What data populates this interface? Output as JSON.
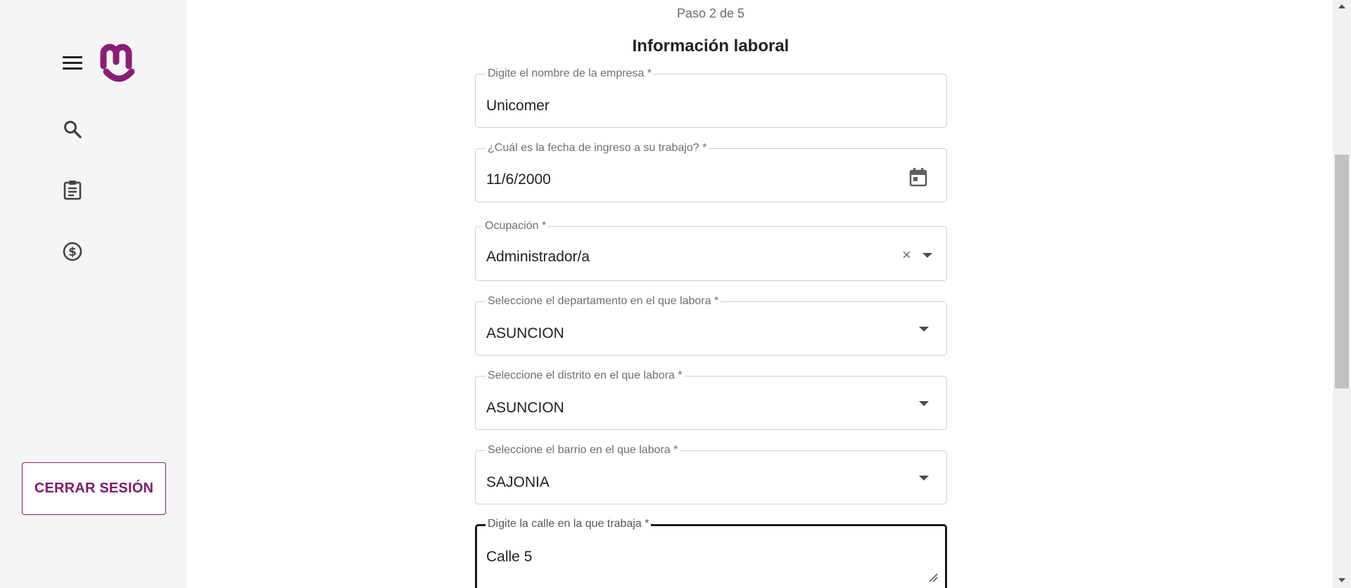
{
  "sidebar": {
    "logout_label": "CERRAR SESIÓN",
    "nav_icons": [
      "menu-icon",
      "search-icon",
      "clipboard-icon",
      "dollar-circle-icon"
    ],
    "brand_color": "#8b1e73"
  },
  "form": {
    "step": "Paso 2 de 5",
    "title": "Información laboral",
    "fields": [
      {
        "label": "Digite el nombre de la empresa *",
        "value": "Unicomer"
      },
      {
        "label": "¿Cuál es la fecha de ingreso a su trabajo? *",
        "value": "11/6/2000"
      },
      {
        "label": "Ocupación *",
        "value": "Administrador/a"
      },
      {
        "label": "Seleccione el departamento en el que labora *",
        "value": "ASUNCION"
      },
      {
        "label": "Seleccione el distrito en el que labora *",
        "value": "ASUNCION"
      },
      {
        "label": "Seleccione el barrio en el que labora *",
        "value": "SAJONIA"
      },
      {
        "label": "Digite la calle en la que trabaja *",
        "value": "Calle 5"
      }
    ]
  }
}
